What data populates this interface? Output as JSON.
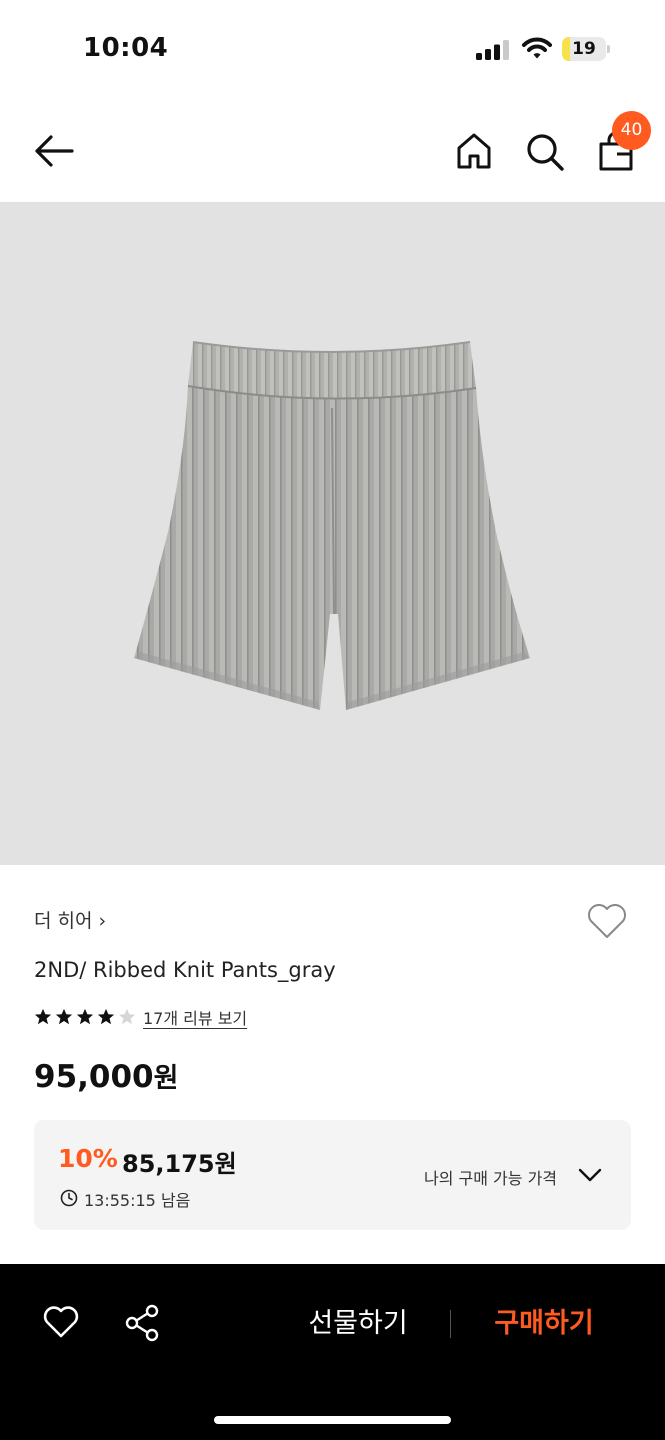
{
  "status_bar": {
    "time": "10:04",
    "battery_level": "19",
    "battery_fill_percent": 19,
    "battery_color": "#f7e349"
  },
  "nav": {
    "back_icon": "arrow-left-icon",
    "home_icon": "home-icon",
    "search_icon": "search-icon",
    "bag_icon": "shopping-bag-icon",
    "cart_count": "40",
    "badge_color": "#ff5a1f"
  },
  "product": {
    "image_description_icon": "ribbed-knit-shorts",
    "brand": "더 히어",
    "brand_chevron": "›",
    "name": "2ND/ Ribbed Knit Pants_gray",
    "rating": 4,
    "rating_max": 5,
    "review_link": "17개 리뷰 보기",
    "price_number": "95,000",
    "price_unit": "원"
  },
  "discount": {
    "rate": "10%",
    "price_number": "85,175",
    "price_unit": "원",
    "timer": "13:55:15 남음",
    "my_price_label": "나의 구매 가능 가격",
    "accent_color": "#ff5a1f"
  },
  "bottom_bar": {
    "gift_label": "선물하기",
    "buy_label": "구매하기",
    "buy_color": "#ff5a1f"
  }
}
